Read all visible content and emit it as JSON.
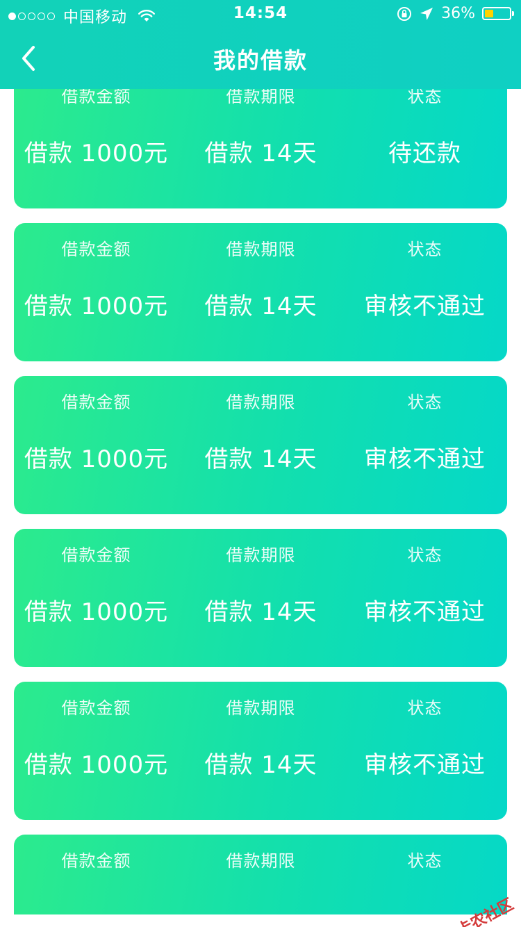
{
  "status_bar": {
    "carrier": "中国移动",
    "time": "14:54",
    "battery_percent": "36%",
    "battery_level": 0.36,
    "battery_color": "#ffd200",
    "signal_strength_of_5": 1
  },
  "nav": {
    "title": "我的借款",
    "back_icon": "chevron-left-icon"
  },
  "colors": {
    "header": "#12d2b8",
    "card_gradient_start": "#2ceb8d",
    "card_gradient_end": "#05d8c8",
    "text": "#ffffff"
  },
  "labels": {
    "amount": "借款金额",
    "term": "借款期限",
    "status": "状态"
  },
  "loans": [
    {
      "amount": "借款 1000元",
      "term": "借款 14天",
      "status": "待还款"
    },
    {
      "amount": "借款 1000元",
      "term": "借款 14天",
      "status": "审核不通过"
    },
    {
      "amount": "借款 1000元",
      "term": "借款 14天",
      "status": "审核不通过"
    },
    {
      "amount": "借款 1000元",
      "term": "借款 14天",
      "status": "审核不通过"
    },
    {
      "amount": "借款 1000元",
      "term": "借款 14天",
      "status": "审核不通过"
    },
    {
      "amount": "",
      "term": "",
      "status": ""
    }
  ],
  "watermark": {
    "text": "卡农社区"
  }
}
